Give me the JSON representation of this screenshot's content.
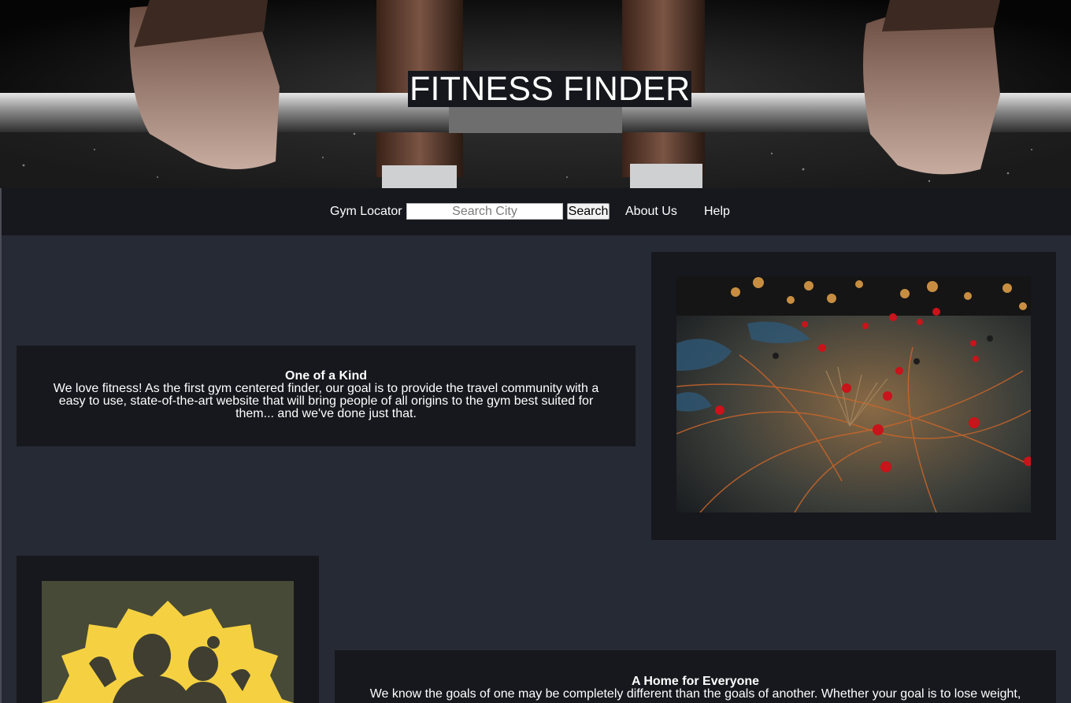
{
  "hero": {
    "title": "FITNESS FINDER"
  },
  "nav": {
    "gym_locator_label": "Gym Locator",
    "search_placeholder": "Search City",
    "search_button_label": "Search",
    "links": [
      {
        "label": "About Us"
      },
      {
        "label": "Help"
      }
    ]
  },
  "sections": [
    {
      "heading": "One of a Kind",
      "body": "We love fitness! As the first gym centered finder, our goal is to provide the travel community with a easy to use, state-of-the-art website that will bring people of all origins to the gym best suited for them... and we've done just that.",
      "image": "map-with-red-pins"
    },
    {
      "heading": "A Home for Everyone",
      "body": "We know the goals of one may be completely different than the goals of another. Whether your goal is to lose weight,",
      "image": "flexing-silhouettes"
    }
  ],
  "colors": {
    "page_background": "#262a34",
    "card_background": "#16181d",
    "nav_background": "#16181d",
    "text": "#ffffff",
    "pin_red": "#c8141a",
    "silhouette_yellow": "#f5d142"
  }
}
